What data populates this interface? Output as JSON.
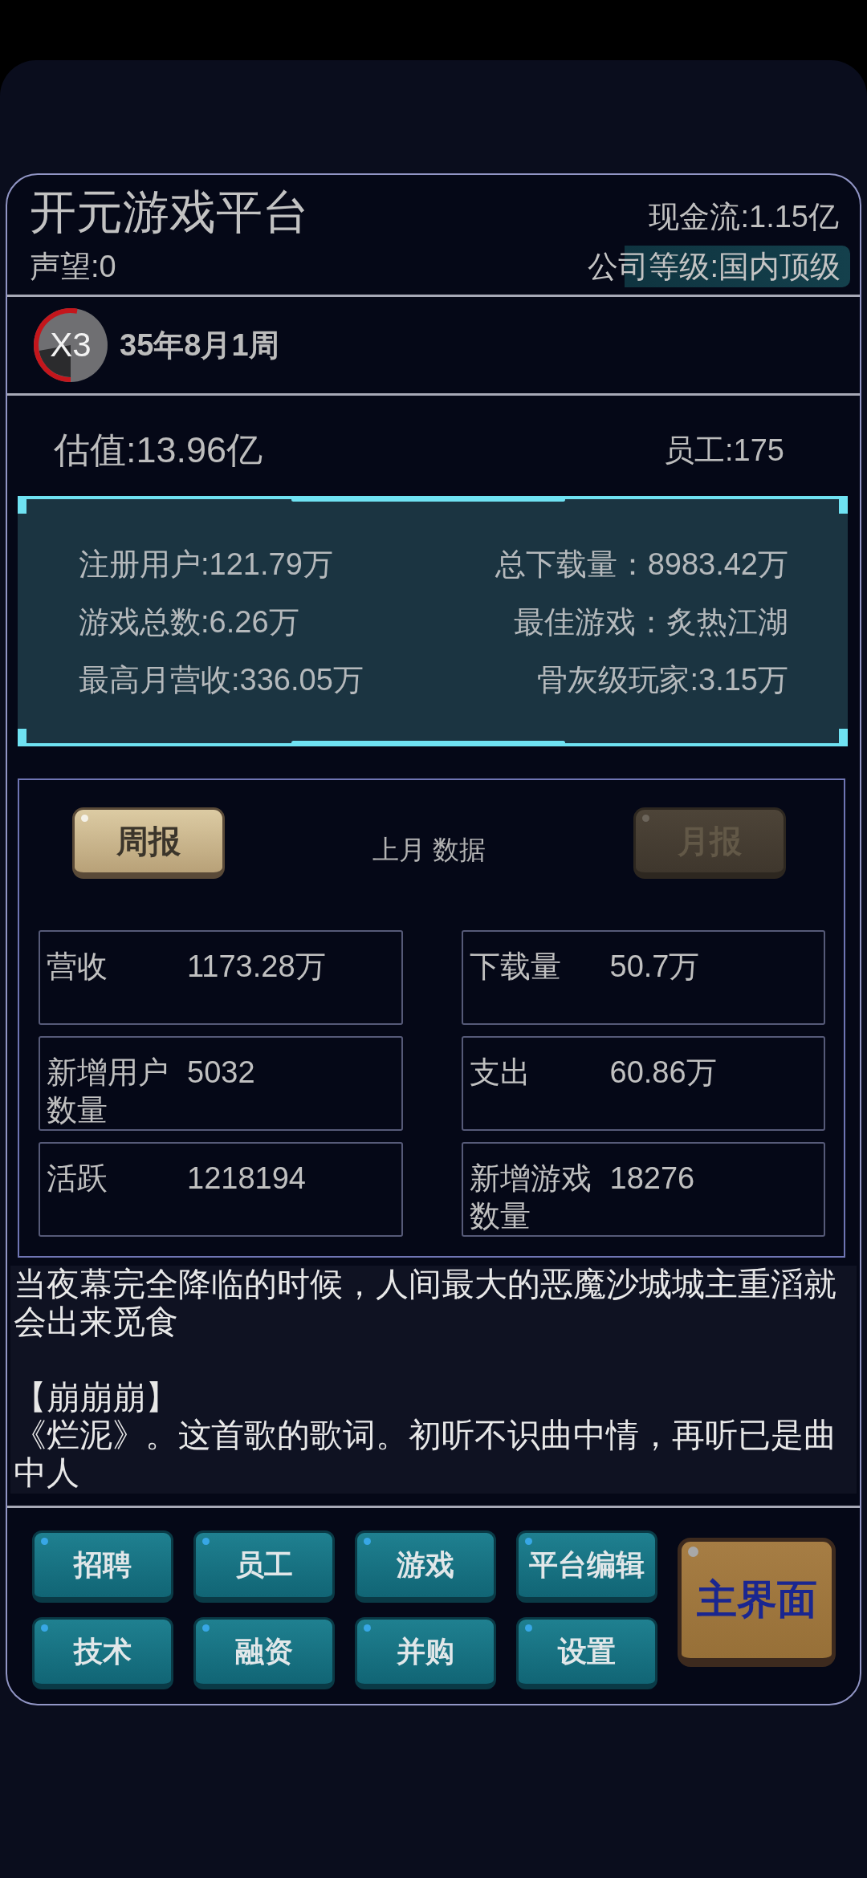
{
  "header": {
    "title": "开元游戏平台",
    "reputation": "声望:0",
    "cash_flow": "现金流:1.15亿",
    "company_level": "公司等级:国内顶级"
  },
  "time_bar": {
    "speed_button": {
      "label": "X3",
      "level": 0.53
    },
    "date": "35年8月1周"
  },
  "summary": {
    "valuation": "估值:13.96亿",
    "employees": "员工:175"
  },
  "stats_panel": {
    "rows": [
      {
        "left": "注册用户:121.79万",
        "right": "总下载量：8983.42万"
      },
      {
        "left": "游戏总数:6.26万",
        "right": "最佳游戏：炙热江湖"
      },
      {
        "left": "最高月营收:336.05万",
        "right": "骨灰级玩家:3.15万"
      }
    ]
  },
  "report": {
    "tabs": [
      {
        "label": "周报",
        "selected": true
      },
      {
        "label": "月报",
        "selected": false
      }
    ],
    "period": "上月 数据",
    "cells": [
      {
        "label": "营收",
        "value": "1173.28万"
      },
      {
        "label": "下载量",
        "value": "50.7万"
      },
      {
        "label": "新增用户数量",
        "value": "5032"
      },
      {
        "label": "支出",
        "value": "60.86万"
      },
      {
        "label": "活跃",
        "value": "1218194"
      },
      {
        "label": "新增游戏数量",
        "value": "18276"
      }
    ]
  },
  "log": {
    "entries": [
      {
        "text": "当夜幕完全降临的时候，人间最大的恶魔沙城城主重滔就会出来觅食"
      },
      {
        "title": "【崩崩崩】",
        "text": "《烂泥》。这首歌的歌词。初听不识曲中情，再听已是曲中人"
      }
    ]
  },
  "menu": {
    "buttons": [
      "招聘",
      "员工",
      "游戏",
      "平台编辑",
      "技术",
      "融资",
      "并购",
      "设置"
    ],
    "home_button": "主界面"
  }
}
